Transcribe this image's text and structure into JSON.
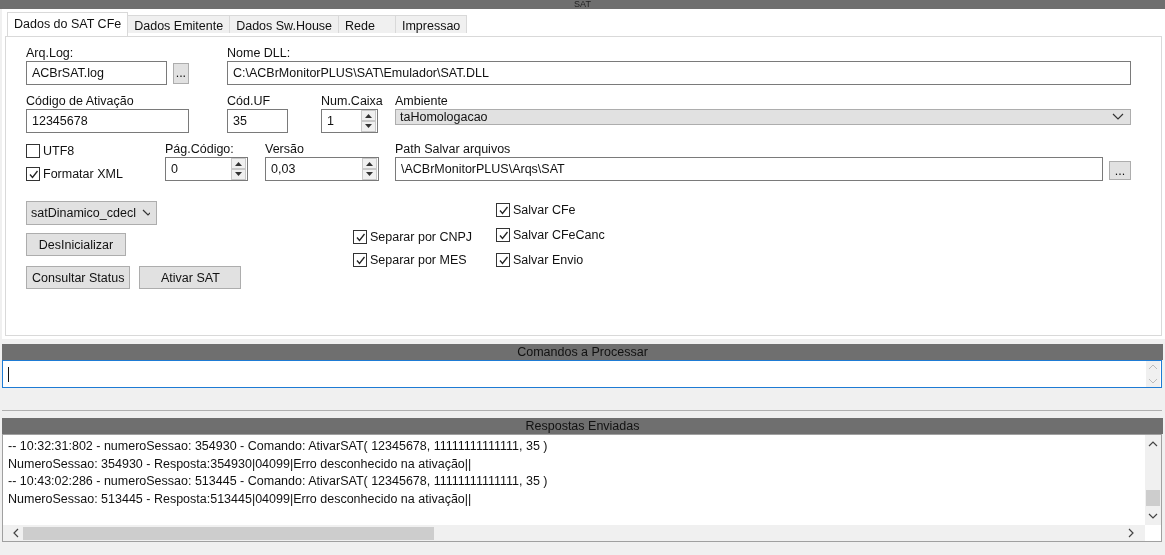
{
  "window": {
    "title": "SAT"
  },
  "tabs": [
    {
      "label": "Dados do SAT CFe",
      "selected": true
    },
    {
      "label": "Dados Emitente",
      "selected": false
    },
    {
      "label": "Dados Sw.House",
      "selected": false
    },
    {
      "label": "Rede",
      "selected": false
    },
    {
      "label": "Impressao",
      "selected": false
    }
  ],
  "form": {
    "arq_log": {
      "label": "Arq.Log:",
      "value": "ACBrSAT.log",
      "browse": "..."
    },
    "nome_dll": {
      "label": "Nome DLL:",
      "value": "C:\\ACBrMonitorPLUS\\SAT\\Emulador\\SAT.DLL"
    },
    "codigo_ativacao": {
      "label": "Código de Ativação",
      "value": "12345678"
    },
    "cod_uf": {
      "label": "Cód.UF",
      "value": "35"
    },
    "num_caixa": {
      "label": "Num.Caixa",
      "value": "1"
    },
    "ambiente": {
      "label": "Ambiente",
      "value": "taHomologacao"
    },
    "utf8": {
      "label": "UTF8",
      "checked": false
    },
    "formatar_xml": {
      "label": "Formatar XML",
      "checked": true
    },
    "pag_codigo": {
      "label": "Pág.Código:",
      "value": "0"
    },
    "versao": {
      "label": "Versão",
      "value": "0,03"
    },
    "path_salvar": {
      "label": "Path Salvar arquivos",
      "value": "\\ACBrMonitorPLUS\\Arqs\\SAT",
      "browse": "..."
    },
    "modelo": {
      "value": "satDinamico_cdecl"
    },
    "button_rows": [
      [
        "DesInicializar"
      ],
      [
        "Consultar Status",
        "Ativar SAT"
      ]
    ],
    "separar": [
      {
        "label": "Separar por CNPJ",
        "checked": true
      },
      {
        "label": "Separar por MES",
        "checked": true
      }
    ],
    "salvar": [
      {
        "label": "Salvar CFe",
        "checked": true
      },
      {
        "label": "Salvar CFeCanc",
        "checked": true
      },
      {
        "label": "Salvar Envio",
        "checked": true
      }
    ]
  },
  "comandos": {
    "title": "Comandos a Processar"
  },
  "respostas": {
    "title": "Respostas Enviadas",
    "lines": [
      "-- 10:32:31:802 - numeroSessao: 354930 - Comando: AtivarSAT( 12345678, 11111111111111, 35 )",
      "NumeroSessao: 354930 - Resposta:354930|04099|Erro desconhecido na ativação||",
      "-- 10:43:02:286 - numeroSessao: 513445 - Comando: AtivarSAT( 12345678, 11111111111111, 35 )",
      "NumeroSessao: 513445 - Resposta:513445|04099|Erro desconhecido na ativação||"
    ]
  }
}
